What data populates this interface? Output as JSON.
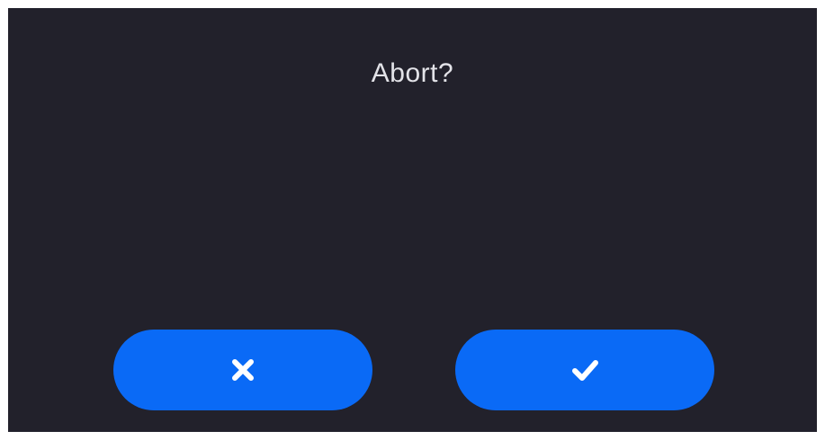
{
  "dialog": {
    "title": "Abort?"
  },
  "buttons": {
    "cancel": {
      "icon": "close-icon"
    },
    "confirm": {
      "icon": "check-icon"
    }
  },
  "colors": {
    "background": "#22212b",
    "accent": "#0a6af6",
    "text": "#e3e3e8",
    "icon": "#ffffff"
  }
}
